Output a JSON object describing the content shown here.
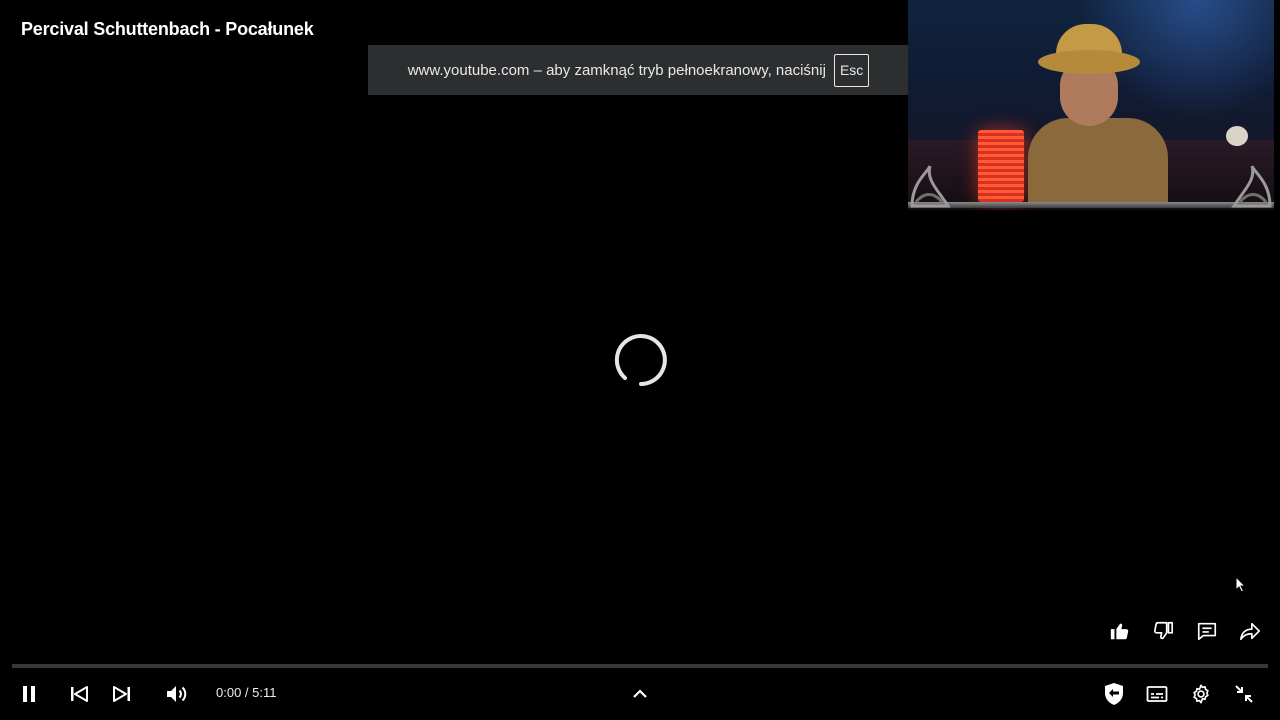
{
  "video": {
    "title": "Percival Schuttenbach - Pocałunek"
  },
  "fullscreen_notice": {
    "message": "www.youtube.com – aby zamknąć tryb pełnoekranowy, naciśnij",
    "key": "Esc"
  },
  "playback": {
    "current_time": "0:00",
    "duration": "5:11",
    "time_display": "0:00 / 5:11",
    "progress_fraction": 0.0,
    "state": "loading"
  },
  "controls": {
    "left": [
      "pause-icon",
      "previous-icon",
      "next-icon",
      "volume-icon"
    ],
    "center": [
      "chevron-up-icon"
    ],
    "right": [
      "adblock-shield-icon",
      "subtitles-icon",
      "settings-icon",
      "exit-fullscreen-icon"
    ]
  },
  "side_actions": [
    "like-icon",
    "dislike-icon",
    "comments-icon",
    "share-icon"
  ],
  "colors": {
    "background": "#000000",
    "notice_bg": "#2c2e30",
    "control_fg": "#ffffff"
  }
}
